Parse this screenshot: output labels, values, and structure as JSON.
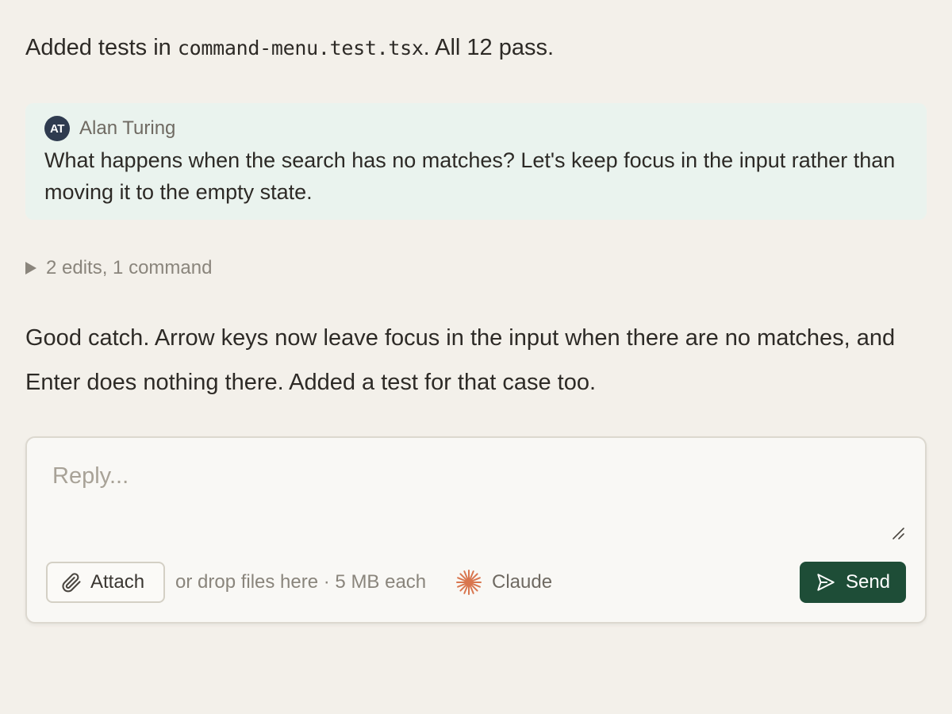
{
  "messages": {
    "intro": {
      "prefix": "Added tests in ",
      "filename": "command-menu.test.tsx",
      "suffix": ". All 12 pass."
    },
    "reply": "Good catch. Arrow keys now leave focus in the input when there are no matches, and Enter does nothing there. Added a test for that case too."
  },
  "comment": {
    "author_initials": "AT",
    "author": "Alan Turing",
    "body": "What happens when the search has no matches? Let's keep focus in the input rather than moving it to the empty state."
  },
  "activity": {
    "summary": "2 edits, 1 command"
  },
  "composer": {
    "placeholder": "Reply...",
    "value": "",
    "attach_label": "Attach",
    "drop_hint": "or drop files here · 5 MB each",
    "model_name": "Claude",
    "send_label": "Send"
  },
  "icons": {
    "attach": "paperclip-icon",
    "model": "claude-starburst-icon",
    "send": "send-arrow-icon",
    "toggle": "triangle-right-icon"
  },
  "colors": {
    "background": "#f3f0ea",
    "comment_bg": "#eaf3ee",
    "avatar_bg": "#2f3b4f",
    "send_bg": "#1e4d37",
    "claude_accent": "#d9764f"
  }
}
